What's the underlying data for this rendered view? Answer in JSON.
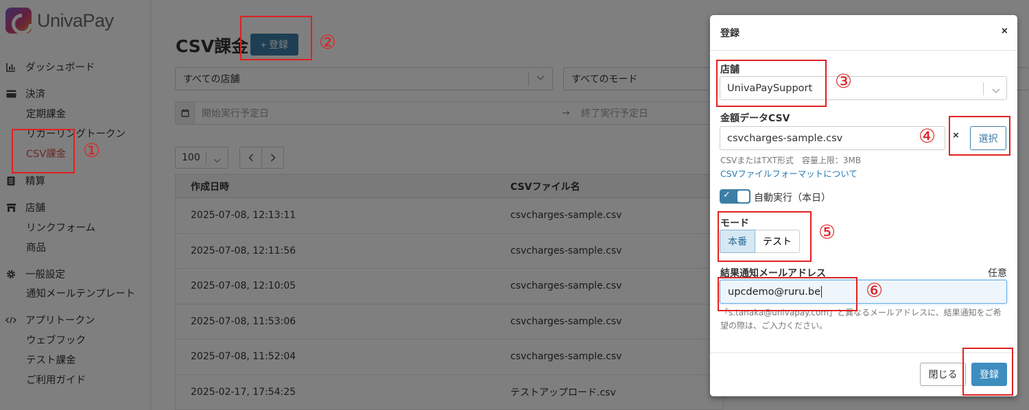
{
  "app": {
    "name": "UnivaPay"
  },
  "sidebar": {
    "groups": [
      {
        "label": "ダッシュボード",
        "icon": "bar-chart-icon"
      },
      {
        "label": "決済",
        "icon": "credit-card-icon"
      },
      {
        "label": "精算",
        "icon": "document-icon"
      },
      {
        "label": "店舗",
        "icon": "store-icon"
      },
      {
        "label": "一般設定",
        "icon": "gear-icon"
      },
      {
        "label": "アプリトークン",
        "icon": "code-icon"
      }
    ],
    "sub": {
      "subscription": "定期課金",
      "recurring_token": "リカーリングトークン",
      "csv_charge": "CSV課金",
      "link_form": "リンクフォーム",
      "products": "商品",
      "email_template": "通知メールテンプレート",
      "webhook": "ウェブフック",
      "test_charge": "テスト課金",
      "guide": "ご利用ガイド"
    }
  },
  "main": {
    "title": "CSV課金",
    "add_button": "+ 登録",
    "filters": {
      "shop": "すべての店舗",
      "mode": "すべてのモード",
      "start_date_placeholder": "開始実行予定日",
      "end_date_placeholder": "終了実行予定日",
      "arrow": "→"
    },
    "per_page": "100",
    "table": {
      "headers": [
        "作成日時",
        "CSVファイル名"
      ],
      "rows": [
        [
          "2025-07-08, 12:13:11",
          "csvcharges-sample.csv"
        ],
        [
          "2025-07-08, 12:11:56",
          "csvcharges-sample.csv"
        ],
        [
          "2025-07-08, 12:10:05",
          "csvcharges-sample.csv"
        ],
        [
          "2025-07-08, 11:53:06",
          "csvcharges-sample.csv"
        ],
        [
          "2025-07-08, 11:52:04",
          "csvcharges-sample.csv"
        ],
        [
          "2025-02-17, 17:54:25",
          "テストアップロード.csv"
        ]
      ]
    }
  },
  "modal": {
    "title": "登録",
    "close_icon": "×",
    "shop_label": "店舗",
    "shop_value": "UnivaPaySupport",
    "csv_label": "金額データCSV",
    "csv_value": "csvcharges-sample.csv",
    "csv_clear": "×",
    "csv_choose": "選択",
    "csv_help": "CSVまたはTXT形式　容量上限：3MB",
    "csv_link": "CSVファイルフォーマットについて",
    "auto_run_label": "自動実行（本日）",
    "auto_run_on": true,
    "mode_label": "モード",
    "mode_options": [
      "本番",
      "テスト"
    ],
    "mode_selected": "本番",
    "email_label": "結果通知メールアドレス",
    "email_optional": "任意",
    "email_value": "upcdemo@ruru.be",
    "email_help": "「s.tanaka@univapay.com」と異なるメールアドレスに、結果通知をご希望の際は、ご入力ください。",
    "close_button": "閉じる",
    "submit_button": "登録"
  },
  "annotations": [
    "①",
    "②",
    "③",
    "④",
    "⑤",
    "⑥"
  ],
  "colors": {
    "accent": "#3d7ea6",
    "annotation": "#e02020",
    "active_nav": "#d9534f"
  }
}
